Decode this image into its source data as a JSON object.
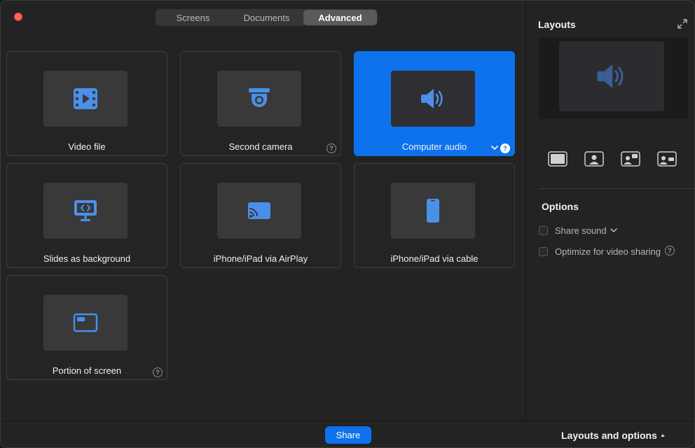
{
  "tabs": [
    {
      "label": "Screens",
      "active": false
    },
    {
      "label": "Documents",
      "active": false
    },
    {
      "label": "Advanced",
      "active": true
    }
  ],
  "tiles": [
    {
      "label": "Video file",
      "icon": "video-file-icon",
      "selected": false,
      "help": false
    },
    {
      "label": "Second camera",
      "icon": "camera-icon",
      "selected": false,
      "help": true
    },
    {
      "label": "Computer audio",
      "icon": "speaker-icon",
      "selected": true,
      "help": true,
      "dropdown": true
    },
    {
      "label": "Slides as background",
      "icon": "slides-icon",
      "selected": false,
      "help": false
    },
    {
      "label": "iPhone/iPad via AirPlay",
      "icon": "airplay-icon",
      "selected": false,
      "help": false
    },
    {
      "label": "iPhone/iPad via cable",
      "icon": "phone-icon",
      "selected": false,
      "help": false
    },
    {
      "label": "Portion of screen",
      "icon": "screen-portion-icon",
      "selected": false,
      "help": true
    }
  ],
  "help_glyph": "?",
  "right_panel": {
    "layouts_title": "Layouts",
    "options_title": "Options",
    "options": [
      {
        "label": "Share sound",
        "checked": false,
        "dropdown": true,
        "help": false
      },
      {
        "label": "Optimize for video sharing",
        "checked": false,
        "dropdown": false,
        "help": true
      }
    ]
  },
  "footer": {
    "share_label": "Share",
    "layouts_options_label": "Layouts and options"
  },
  "colors": {
    "accent": "#0e72ed",
    "icon_blue": "#4a90e8",
    "close": "#ff5f57"
  }
}
